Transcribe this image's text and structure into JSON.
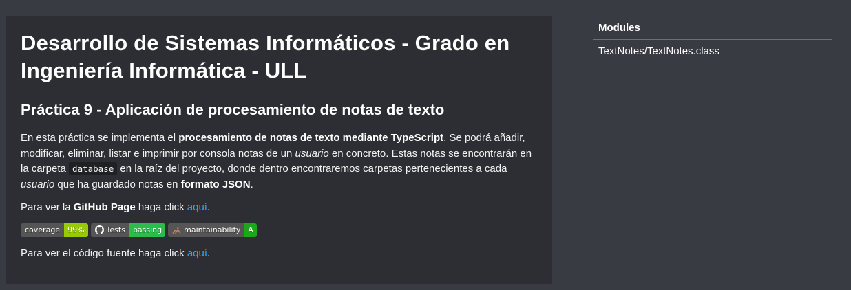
{
  "content": {
    "title": "Desarrollo de Sistemas Informáticos - Grado en Ingeniería Informática - ULL",
    "subtitle": "Práctica 9 - Aplicación de procesamiento de notas de texto",
    "paragraph1": {
      "t1": "En esta práctica se implementa el ",
      "b1": "procesamiento de notas de texto mediante TypeScript",
      "t2": ". Se podrá añadir, modificar, eliminar, listar e imprimir por consola notas de un ",
      "i1": "usuario",
      "t3": " en concreto. Estas notas se encontrarán en la carpeta ",
      "code1": "database",
      "t4": " en la raíz del proyecto, donde dentro encontraremos carpetas pertenecientes a cada ",
      "i2": "usuario",
      "t5": " que ha guardado notas en ",
      "b2": "formato JSON",
      "t6": "."
    },
    "paragraph2": {
      "t1": "Para ver la ",
      "b1": "GitHub Page",
      "t2": " haga click ",
      "link": "aquí",
      "t3": "."
    },
    "paragraph3": {
      "t1": "Para ver el código fuente haga click ",
      "link": "aquí",
      "t2": "."
    }
  },
  "badges": [
    {
      "label": "coverage",
      "value": "99%",
      "color": "#97ca00",
      "icon": ""
    },
    {
      "label": "Tests",
      "value": "passing",
      "color": "#2dbb4e",
      "icon": "github-icon"
    },
    {
      "label": "maintainability",
      "value": "A",
      "color": "#1aa81a",
      "icon": "codeclimate-icon"
    }
  ],
  "sidebar": {
    "heading": "Modules",
    "items": [
      {
        "label": "TextNotes/TextNotes.class"
      }
    ]
  },
  "colors": {
    "background": "#393b43",
    "panel": "#2d2e33",
    "link": "#2aa6ff"
  }
}
